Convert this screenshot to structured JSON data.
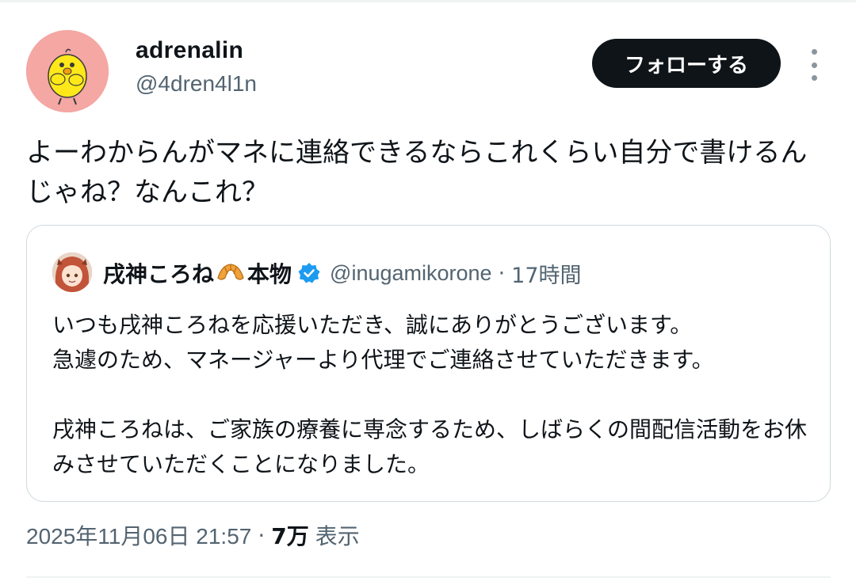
{
  "author": {
    "display_name": "adrenalin",
    "handle": "@4dren4l1n",
    "avatar_icon": "yellow-chick-avatar"
  },
  "follow_label": "フォローする",
  "more_icon": "vertical-ellipsis-icon",
  "tweet": {
    "text": "よーわからんがマネに連絡できるならこれくらい自分で書けるんじゃね？なんこれ？"
  },
  "quote": {
    "display_name": "戌神ころね",
    "display_name_suffix": "本物",
    "name_emoji": "croissant-icon",
    "verified_icon": "verified-badge-icon",
    "handle": "@inugamikorone",
    "separator": "·",
    "time": "17時間",
    "text": "いつも戌神ころねを応援いただき、誠にありがとうございます。\n急遽のため、マネージャーより代理でご連絡させていただきます。\n\n戌神ころねは、ご家族の療養に専念するため、しばらくの間配信活動をお休みさせていただくことになりました。"
  },
  "meta": {
    "timestamp": "2025年11月06日 21:57",
    "separator": "·",
    "views": "7万",
    "views_label": "表示"
  },
  "colors": {
    "text_primary": "#0f1419",
    "text_secondary": "#536471",
    "border": "#cfd9de",
    "follow_bg": "#0f1419",
    "verified": "#1d9bf0",
    "avatar_bg": "#f4a7a3"
  }
}
